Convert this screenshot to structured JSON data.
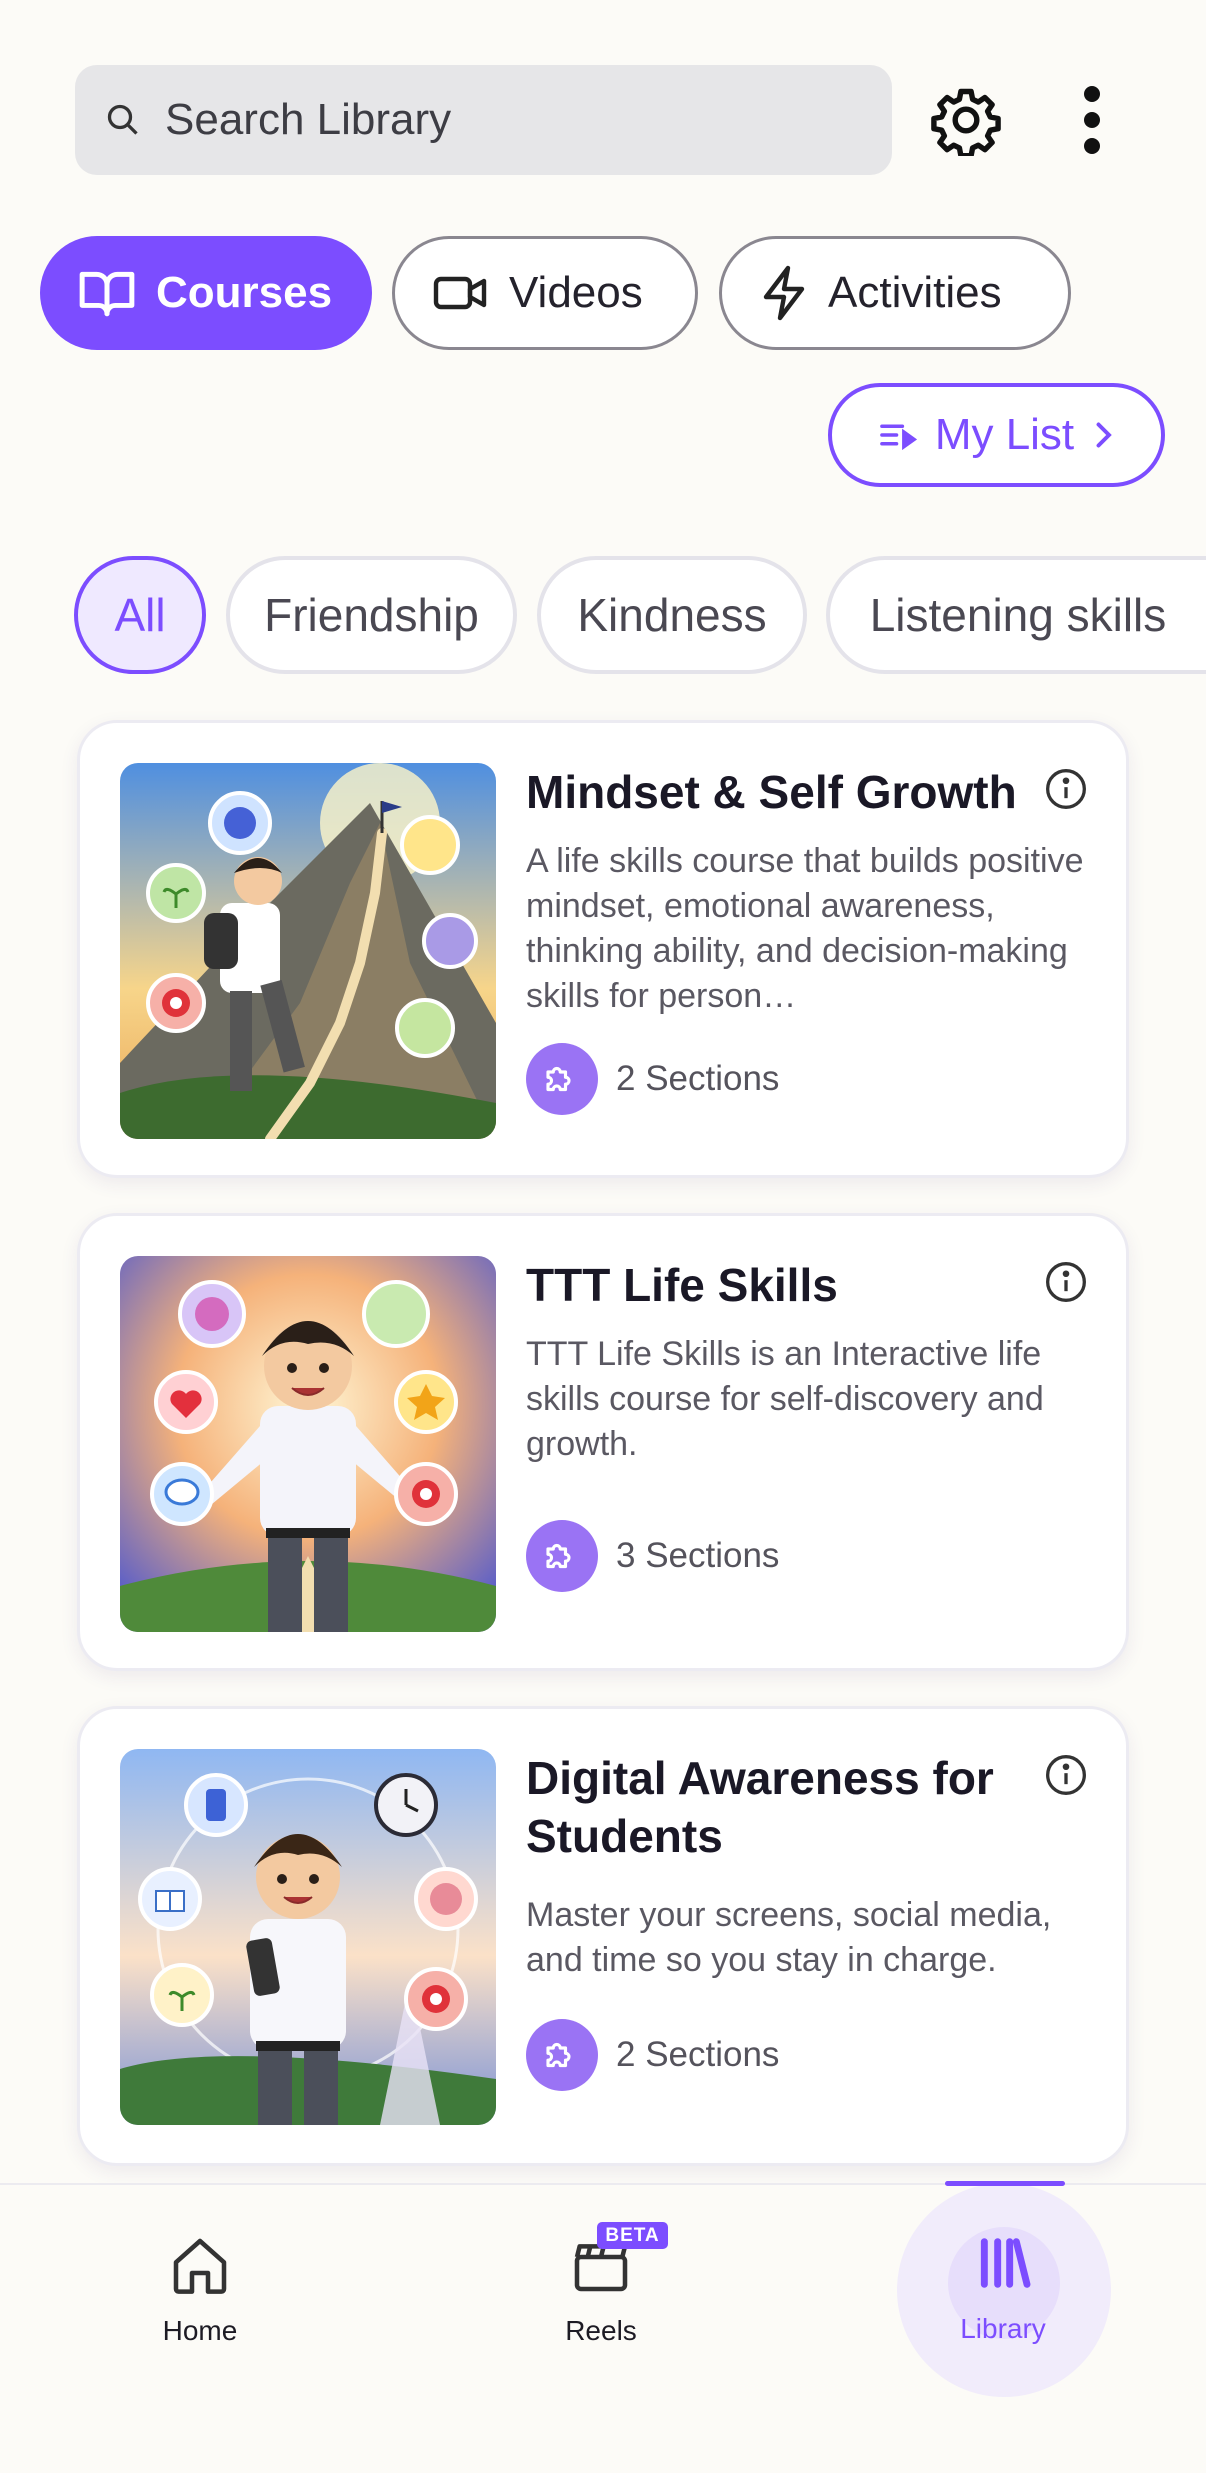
{
  "search": {
    "placeholder": "Search Library"
  },
  "tabs": [
    {
      "label": "Courses",
      "icon": "book-icon",
      "active": true
    },
    {
      "label": "Videos",
      "icon": "video-camera-icon",
      "active": false
    },
    {
      "label": "Activities",
      "icon": "lightning-icon",
      "active": false
    }
  ],
  "my_list": {
    "label": "My List"
  },
  "chips": [
    "All",
    "Friendship",
    "Kindness",
    "Listening skills"
  ],
  "courses": [
    {
      "title": "Mindset & Self Growth",
      "description": "A life skills course that builds positive mindset, emotional awareness, thinking ability, and decision-making skills for person…",
      "sections": "2 Sections"
    },
    {
      "title": "TTT Life Skills",
      "description": "TTT Life Skills is an Interactive life skills course for self-discovery and growth.",
      "sections": "3 Sections"
    },
    {
      "title": "Digital Awareness for Students",
      "description": "Master your screens, social media, and time so you stay in charge.",
      "sections": "2 Sections"
    }
  ],
  "nav": {
    "home": "Home",
    "reels": "Reels",
    "reels_badge": "BETA",
    "library": "Library"
  },
  "colors": {
    "accent": "#7c4dff",
    "puzzle": "#9a73f4"
  }
}
